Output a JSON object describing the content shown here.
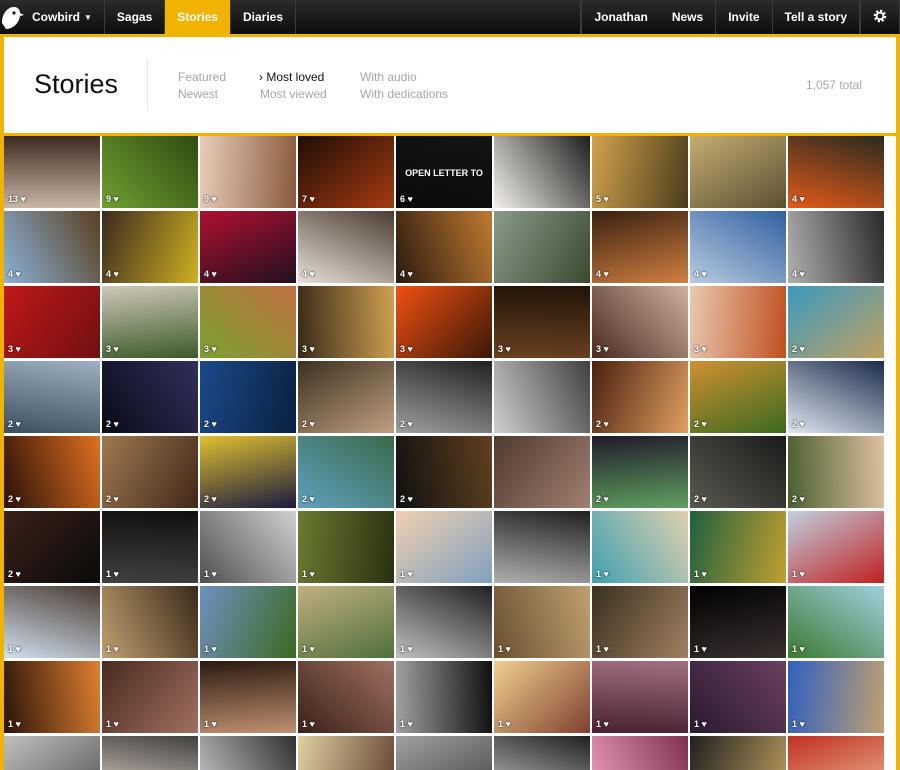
{
  "nav": {
    "brand": "Cowbird",
    "items": [
      {
        "label": "Sagas",
        "active": false
      },
      {
        "label": "Stories",
        "active": true
      },
      {
        "label": "Diaries",
        "active": false
      }
    ],
    "right_items": [
      "Jonathan",
      "News",
      "Invite",
      "Tell a story"
    ],
    "settings_icon": "gear-icon",
    "logo_icon": "cowbird-logo-icon"
  },
  "header": {
    "title": "Stories",
    "filters": [
      {
        "label": "Featured",
        "selected": false
      },
      {
        "label": "Newest",
        "selected": false
      },
      {
        "label": "› Most loved",
        "selected": true
      },
      {
        "label": "Most viewed",
        "selected": false
      },
      {
        "label": "With audio",
        "selected": false
      },
      {
        "label": "With dedications",
        "selected": false
      }
    ],
    "total": "1,057 total"
  },
  "colors": {
    "accent": "#f0b400",
    "nav_bg": "#1a1a1a"
  },
  "grid": {
    "tiles": [
      {
        "loves": "13 ♥",
        "colors": [
          "#c9b7a6",
          "#3b2a20"
        ],
        "text": ""
      },
      {
        "loves": "9 ♥",
        "colors": [
          "#6fa030",
          "#2f4a12"
        ],
        "text": ""
      },
      {
        "loves": "9 ♥",
        "colors": [
          "#e8cdbb",
          "#8a5a3c"
        ],
        "text": ""
      },
      {
        "loves": "7 ♥",
        "colors": [
          "#1e0e08",
          "#a63a10"
        ],
        "text": ""
      },
      {
        "loves": "6 ♥",
        "colors": [
          "#0a0a0a",
          "#141414"
        ],
        "text": "OPEN LETTER TO"
      },
      {
        "loves": "",
        "colors": [
          "#f4f2ea",
          "#1e1e1e"
        ],
        "text": ""
      },
      {
        "loves": "5 ♥",
        "colors": [
          "#d2a24c",
          "#4a3c1c"
        ],
        "text": ""
      },
      {
        "loves": "",
        "colors": [
          "#c5ad74",
          "#5a5030"
        ],
        "text": ""
      },
      {
        "loves": "4 ♥",
        "colors": [
          "#e25a18",
          "#2a2a20"
        ],
        "text": ""
      },
      {
        "loves": "4 ♥",
        "colors": [
          "#8ab0d8",
          "#5a4020"
        ],
        "text": ""
      },
      {
        "loves": "4 ♥",
        "colors": [
          "#3a2a20",
          "#d0b020"
        ],
        "text": ""
      },
      {
        "loves": "4 ♥",
        "colors": [
          "#b01030",
          "#201020"
        ],
        "text": ""
      },
      {
        "loves": "4 ♥",
        "colors": [
          "#e8e0d8",
          "#4a3c30"
        ],
        "text": ""
      },
      {
        "loves": "4 ♥",
        "colors": [
          "#2a1a10",
          "#c07a30"
        ],
        "text": ""
      },
      {
        "loves": "",
        "colors": [
          "#8a9a8a",
          "#3a4a30"
        ],
        "text": ""
      },
      {
        "loves": "4 ♥",
        "colors": [
          "#3a2010",
          "#d08040"
        ],
        "text": ""
      },
      {
        "loves": "4 ♥",
        "colors": [
          "#b8cce0",
          "#3060a0"
        ],
        "text": ""
      },
      {
        "loves": "4 ♥",
        "colors": [
          "#b0b0b0",
          "#2a2a2a"
        ],
        "text": ""
      },
      {
        "loves": "3 ♥",
        "colors": [
          "#c01818",
          "#701010"
        ],
        "text": ""
      },
      {
        "loves": "3 ♥",
        "colors": [
          "#d0c8b8",
          "#3a5a2a"
        ],
        "text": ""
      },
      {
        "loves": "3 ♥",
        "colors": [
          "#7aa030",
          "#c07040"
        ],
        "text": ""
      },
      {
        "loves": "3 ♥",
        "colors": [
          "#3a2a1a",
          "#d0a050"
        ],
        "text": ""
      },
      {
        "loves": "3 ♥",
        "colors": [
          "#f05010",
          "#3a1808"
        ],
        "text": ""
      },
      {
        "loves": "3 ♥",
        "colors": [
          "#6a4020",
          "#201408"
        ],
        "text": ""
      },
      {
        "loves": "3 ♥",
        "colors": [
          "#4a2a20",
          "#d0b0a0"
        ],
        "text": ""
      },
      {
        "loves": "3 ♥",
        "colors": [
          "#e8c8b0",
          "#c05020"
        ],
        "text": ""
      },
      {
        "loves": "2 ♥",
        "colors": [
          "#3a9ac0",
          "#c0a060"
        ],
        "text": ""
      },
      {
        "loves": "2 ♥",
        "colors": [
          "#3a5060",
          "#a0b0c0"
        ],
        "text": ""
      },
      {
        "loves": "2 ♥",
        "colors": [
          "#0a0a18",
          "#30305a"
        ],
        "text": ""
      },
      {
        "loves": "2 ♥",
        "colors": [
          "#1a4a8a",
          "#0a2040"
        ],
        "text": ""
      },
      {
        "loves": "2 ♥",
        "colors": [
          "#3a3020",
          "#c0a080"
        ],
        "text": ""
      },
      {
        "loves": "2 ♥",
        "colors": [
          "#a0a0a0",
          "#202020"
        ],
        "text": ""
      },
      {
        "loves": "",
        "colors": [
          "#d0d0d0",
          "#404040"
        ],
        "text": ""
      },
      {
        "loves": "2 ♥",
        "colors": [
          "#4a2010",
          "#e0a060"
        ],
        "text": ""
      },
      {
        "loves": "2 ♥",
        "colors": [
          "#d09030",
          "#3a6a20"
        ],
        "text": ""
      },
      {
        "loves": "2 ♥",
        "colors": [
          "#e0e8f0",
          "#1a2a4a"
        ],
        "text": ""
      },
      {
        "loves": "2 ♥",
        "colors": [
          "#2a1008",
          "#e07020"
        ],
        "text": ""
      },
      {
        "loves": "2 ♥",
        "colors": [
          "#a07850",
          "#402818"
        ],
        "text": ""
      },
      {
        "loves": "2 ♥",
        "colors": [
          "#e0c030",
          "#1a1a40"
        ],
        "text": ""
      },
      {
        "loves": "2 ♥",
        "colors": [
          "#60a0c0",
          "#3a6a4a"
        ],
        "text": ""
      },
      {
        "loves": "2 ♥",
        "colors": [
          "#101010",
          "#604020"
        ],
        "text": ""
      },
      {
        "loves": "",
        "colors": [
          "#503a30",
          "#a08070"
        ],
        "text": ""
      },
      {
        "loves": "2 ♥",
        "colors": [
          "#201a2a",
          "#60a060"
        ],
        "text": ""
      },
      {
        "loves": "2 ♥",
        "colors": [
          "#5a5a50",
          "#1a1a1a"
        ],
        "text": ""
      },
      {
        "loves": "2 ♥",
        "colors": [
          "#4a6030",
          "#e0c0a0"
        ],
        "text": ""
      },
      {
        "loves": "2 ♥",
        "colors": [
          "#3a2018",
          "#0a0a0a"
        ],
        "text": ""
      },
      {
        "loves": "1 ♥",
        "colors": [
          "#404040",
          "#101010"
        ],
        "text": ""
      },
      {
        "loves": "1 ♥",
        "colors": [
          "#505050",
          "#d0d0d0"
        ],
        "text": ""
      },
      {
        "loves": "1 ♥",
        "colors": [
          "#6a7a30",
          "#2a3010"
        ],
        "text": ""
      },
      {
        "loves": "1 ♥",
        "colors": [
          "#f0d0b0",
          "#80a0c0"
        ],
        "text": ""
      },
      {
        "loves": "",
        "colors": [
          "#b0b0b0",
          "#202020"
        ],
        "text": ""
      },
      {
        "loves": "1 ♥",
        "colors": [
          "#40a0b0",
          "#e0d0b0"
        ],
        "text": ""
      },
      {
        "loves": "1 ♥",
        "colors": [
          "#206040",
          "#c0a030"
        ],
        "text": ""
      },
      {
        "loves": "1 ♥",
        "colors": [
          "#c0d0e0",
          "#c02020"
        ],
        "text": ""
      },
      {
        "loves": "1 ♥",
        "colors": [
          "#d0e0f0",
          "#4a3a30"
        ],
        "text": ""
      },
      {
        "loves": "1 ♥",
        "colors": [
          "#c0a070",
          "#3a2a1a"
        ],
        "text": ""
      },
      {
        "loves": "1 ♥",
        "colors": [
          "#7090c0",
          "#3a6a20"
        ],
        "text": ""
      },
      {
        "loves": "1 ♥",
        "colors": [
          "#c0b080",
          "#50703a"
        ],
        "text": ""
      },
      {
        "loves": "1 ♥",
        "colors": [
          "#c0c0c0",
          "#202020"
        ],
        "text": ""
      },
      {
        "loves": "1 ♥",
        "colors": [
          "#6a5030",
          "#c0a070"
        ],
        "text": ""
      },
      {
        "loves": "1 ♥",
        "colors": [
          "#3a3020",
          "#a08060"
        ],
        "text": ""
      },
      {
        "loves": "1 ♥",
        "colors": [
          "#000000",
          "#3a3030"
        ],
        "text": ""
      },
      {
        "loves": "1 ♥",
        "colors": [
          "#3a7a30",
          "#a0d0e0"
        ],
        "text": ""
      },
      {
        "loves": "1 ♥",
        "colors": [
          "#2a1408",
          "#e08030"
        ],
        "text": ""
      },
      {
        "loves": "1 ♥",
        "colors": [
          "#4a2a20",
          "#a07060"
        ],
        "text": ""
      },
      {
        "loves": "1 ♥",
        "colors": [
          "#2a1a10",
          "#c09070"
        ],
        "text": ""
      },
      {
        "loves": "1 ♥",
        "colors": [
          "#3a2018",
          "#a07060"
        ],
        "text": ""
      },
      {
        "loves": "1 ♥",
        "colors": [
          "#a0a0a0",
          "#101010"
        ],
        "text": ""
      },
      {
        "loves": "1 ♥",
        "colors": [
          "#f0d090",
          "#804030"
        ],
        "text": ""
      },
      {
        "loves": "1 ♥",
        "colors": [
          "#4a2030",
          "#a07080"
        ],
        "text": ""
      },
      {
        "loves": "1 ♥",
        "colors": [
          "#2a1a30",
          "#6a4060"
        ],
        "text": ""
      },
      {
        "loves": "1 ♥",
        "colors": [
          "#3060c0",
          "#c0a070"
        ],
        "text": ""
      },
      {
        "loves": "",
        "colors": [
          "#c0c0c0",
          "#505050"
        ],
        "text": ""
      },
      {
        "loves": "",
        "colors": [
          "#f0e0d0",
          "#404040"
        ],
        "text": ""
      },
      {
        "loves": "",
        "colors": [
          "#d0d0d0",
          "#303030"
        ],
        "text": ""
      },
      {
        "loves": "",
        "colors": [
          "#e0d0a0",
          "#604030"
        ],
        "text": ""
      },
      {
        "loves": "",
        "colors": [
          "#a0a0a0",
          "#404040"
        ],
        "text": ""
      },
      {
        "loves": "",
        "colors": [
          "#d0d0d0",
          "#202020"
        ],
        "text": ""
      },
      {
        "loves": "",
        "colors": [
          "#f0a0c0",
          "#803050"
        ],
        "text": ""
      },
      {
        "loves": "",
        "colors": [
          "#202020",
          "#c0a060"
        ],
        "text": ""
      },
      {
        "loves": "",
        "colors": [
          "#c03020",
          "#f0c0a0"
        ],
        "text": ""
      }
    ]
  }
}
